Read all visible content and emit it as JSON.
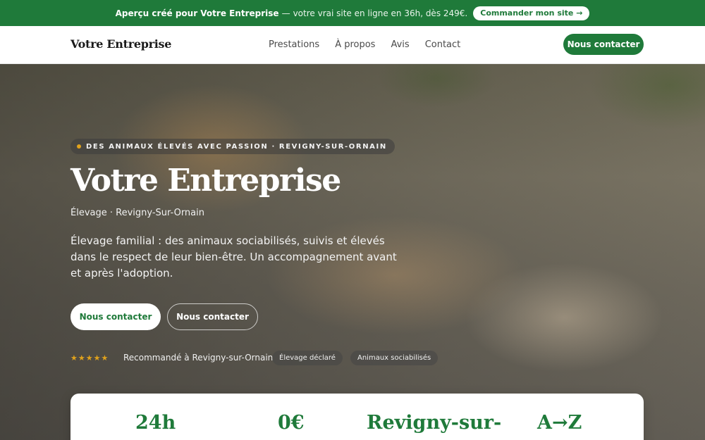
{
  "promo": {
    "text_bold": "Aperçu créé pour Votre Entreprise",
    "text_rest": "votre vrai site en ligne en 36h, dès 249€.",
    "separator": "—",
    "button_label": "Commander mon site →"
  },
  "header": {
    "logo": "Votre Entreprise",
    "nav": [
      "Prestations",
      "À propos",
      "Avis",
      "Contact"
    ],
    "cta_label": "Nous contacter"
  },
  "hero": {
    "badge": "DES ANIMAUX ÉLEVÉS AVEC PASSION · REVIGNY-SUR-ORNAIN",
    "title": "Votre Entreprise",
    "subtitle": "Élevage · Revigny-Sur-Ornain",
    "description": "Élevage familial : des animaux sociabilisés, suivis et élevés dans le respect de leur bien-être. Un accompagnement avant et après l'adoption.",
    "primary_button": "Nous contacter",
    "secondary_button": "Nous contacter",
    "stars": "★★★★★",
    "rating": 5,
    "recommendation": "Recommandé à Revigny-sur-Ornain",
    "chips": [
      "Élevage déclaré",
      "Animaux sociabilisés"
    ]
  },
  "stats": [
    "24h",
    "0€",
    "Revigny-sur-",
    "A→Z"
  ],
  "colors": {
    "brand_green": "#1f7a3a",
    "star_gold": "#e0a21c"
  }
}
